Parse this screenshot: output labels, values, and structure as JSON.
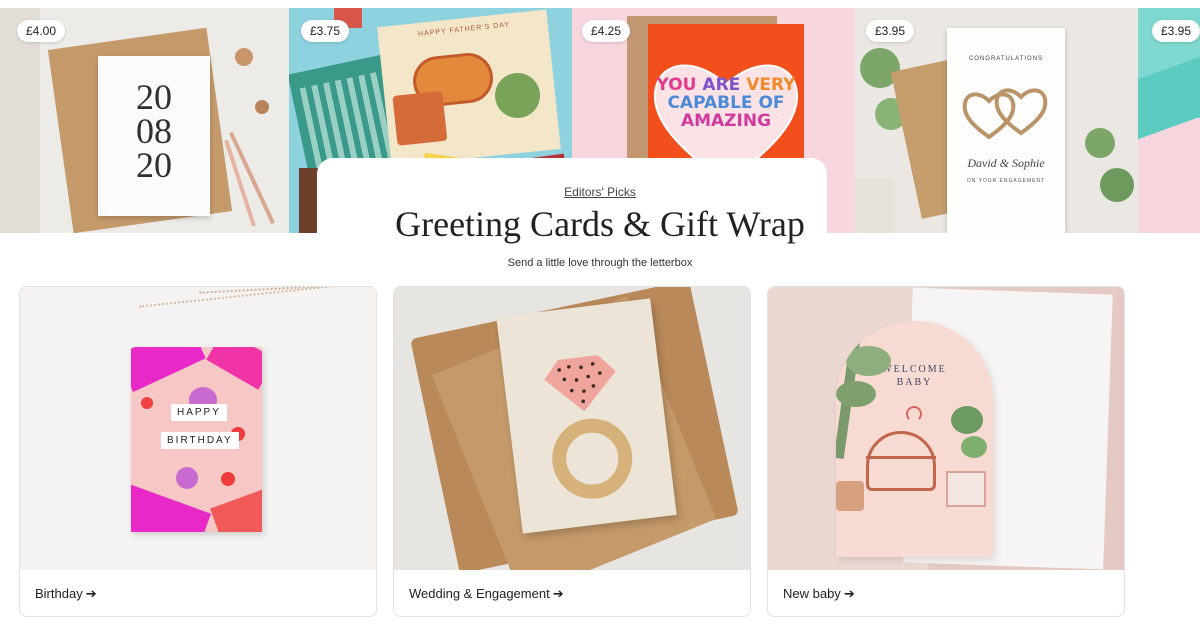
{
  "hero": {
    "tiles": [
      {
        "price": "£4.00",
        "card_text": [
          "20",
          "08",
          "20"
        ]
      },
      {
        "price": "£3.75",
        "card_text": "HAPPY FATHER'S DAY"
      },
      {
        "price": "£4.25",
        "card_text": [
          "YOU",
          "ARE",
          "VERY",
          "CAPABLE OF",
          "AMAZING"
        ]
      },
      {
        "price": "£3.95",
        "card_text": [
          "CONGRATULATIONS",
          "David & Sophie",
          "ON YOUR ENGAGEMENT"
        ]
      },
      {
        "price": "£3.95"
      }
    ]
  },
  "section": {
    "kicker": "Editors' Picks",
    "title": "Greeting Cards & Gift Wrap",
    "subtitle": "Send a little love through the letterbox"
  },
  "categories": [
    {
      "label": "Birthday",
      "arrow": "➔",
      "card_text": [
        "HAPPY",
        "BIRTHDAY"
      ]
    },
    {
      "label": "Wedding & Engagement",
      "arrow": "➔"
    },
    {
      "label": "New baby",
      "arrow": "➔",
      "card_text": [
        "WELCOME",
        "BABY"
      ]
    }
  ]
}
